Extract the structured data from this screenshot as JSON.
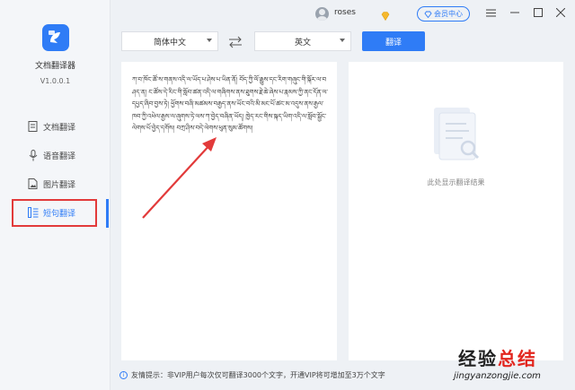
{
  "app": {
    "name": "文档翻译器",
    "version": "V1.0.0.1"
  },
  "sidebar": {
    "items": [
      {
        "label": "文档翻译",
        "icon": "document-icon"
      },
      {
        "label": "语音翻译",
        "icon": "microphone-icon"
      },
      {
        "label": "图片翻译",
        "icon": "image-icon"
      },
      {
        "label": "短句翻译",
        "icon": "text-icon",
        "active": true
      }
    ]
  },
  "header": {
    "username": "roses",
    "vip_label": "会员中心"
  },
  "toolbar": {
    "source_lang": "简体中文",
    "target_lang": "英文",
    "translate_label": "翻译"
  },
  "source_text": "ཀ་བ་ཁོང་ཚོ་ས་གནས་འདི་ལ་ཡོད་པ་ཤེས་པ་ཡིན་ནོ། བོད་ཀྱི་ལོ་རྒྱུས་དང་རིག་གཞུང་གི་སྐོར་ལ་བཤད་ན། ང་ཚོས་དེ་རིང་གི་སློབ་ཚན་འདི་ལ་གཞིགས་ནས་ཐུགས་རྗེ་ཆེ་ཞེས་པ་རྣམས་ཀྱི་ནང་དོན་ལ་དཔྱད་ཞིབ་བྱས་ཏེ། ཕྱོགས་བཞི་མཚམས་བརྒྱད་ནས་ཡོང་བའི་མི་མང་པོ་ཚང་མ་འདུས་ནས་རྒྱལ་ཁབ་ཀྱི་འཕེལ་རྒྱས་ལ་ཞུགས་ཏེ་ལས་ཀ་བྱེད་བཞིན་ཡོད། ཁྱེད་རང་གིས་སྐད་ཡིག་འདི་ལ་སློབ་སྦྱོང་ལེགས་པོ་བྱེད་དགོས། བཀྲ་ཤིས་བདེ་ལེགས་ཕུན་སུམ་ཚོགས།",
  "result": {
    "placeholder": "此处显示翻译结果"
  },
  "footer": {
    "tip": "友情提示：非VIP用户每次仅可翻译3000个文字，开通VIP将可增加至3万个文字"
  },
  "watermark": {
    "logo_a": "经验",
    "logo_b": "总结",
    "url": "jingyanzongjie.com"
  },
  "colors": {
    "accent": "#2f7cf6",
    "highlight": "#e23a3a"
  }
}
